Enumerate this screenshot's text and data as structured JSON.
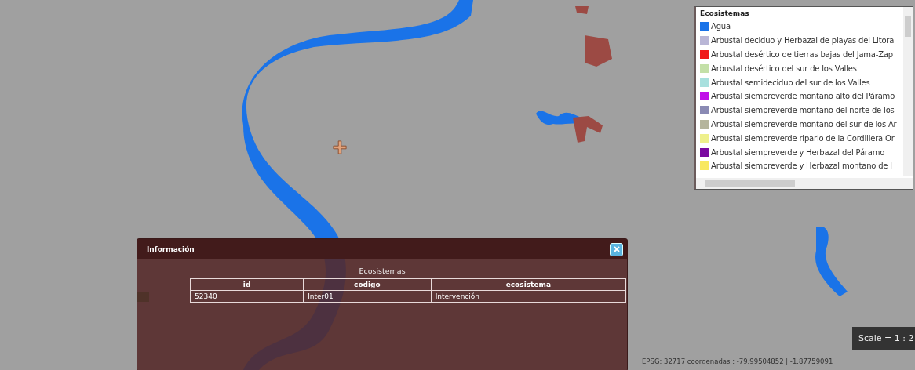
{
  "legend": {
    "title": "Ecosistemas",
    "items": [
      {
        "label": "Agua",
        "color": "#1a73e8"
      },
      {
        "label": "Arbustal deciduo y Herbazal de playas del Litora",
        "color": "#b9b6d6"
      },
      {
        "label": "Arbustal desértico de tierras bajas del Jama-Zap",
        "color": "#f01818"
      },
      {
        "label": "Arbustal desértico del sur de los Valles",
        "color": "#c4e0a8"
      },
      {
        "label": "Arbustal semideciduo del sur de los Valles",
        "color": "#a8e0de"
      },
      {
        "label": "Arbustal siempreverde montano alto del Páramo",
        "color": "#c010e8"
      },
      {
        "label": "Arbustal siempreverde montano del norte de los",
        "color": "#8a8ab4"
      },
      {
        "label": "Arbustal siempreverde montano del sur de los Ar",
        "color": "#b4b49c"
      },
      {
        "label": "Arbustal siempreverde ripario de la Cordillera Or",
        "color": "#eef08c"
      },
      {
        "label": "Arbustal siempreverde y Herbazal del Páramo",
        "color": "#7a0aa0"
      },
      {
        "label": "Arbustal siempreverde y Herbazal montano de l",
        "color": "#f8e860"
      }
    ]
  },
  "info_panel": {
    "title": "Información",
    "table": {
      "caption": "Ecosistemas",
      "columns": [
        "id",
        "codigo",
        "ecosistema"
      ],
      "rows": [
        [
          "52340",
          "Inter01",
          "Intervención"
        ]
      ]
    }
  },
  "scale": "Scale = 1 : 2",
  "coordinates": "EPSG: 32717 coordenadas : -79.99504852 | -1.87759091"
}
